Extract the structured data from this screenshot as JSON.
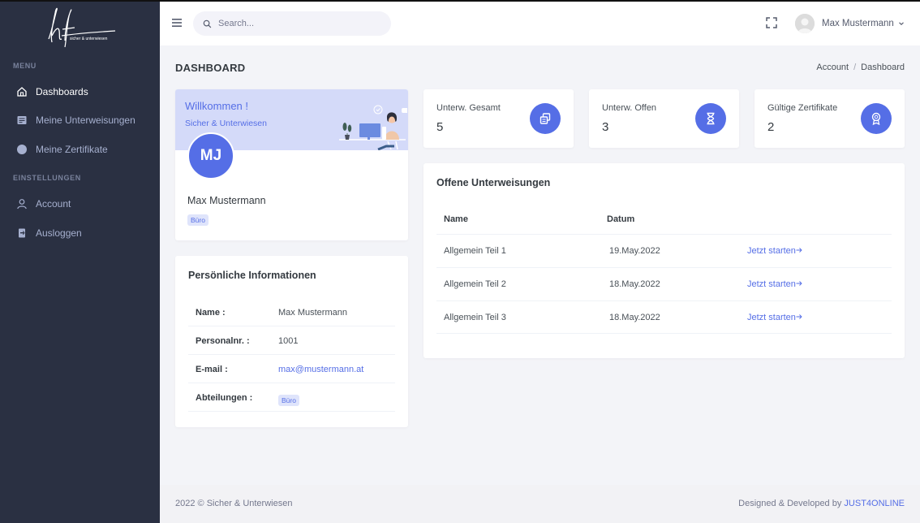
{
  "logo": {
    "text": "sicher & unterwiesen"
  },
  "sidebar": {
    "menu_title": "MENU",
    "settings_title": "EINSTELLUNGEN",
    "items": [
      {
        "label": "Dashboards",
        "icon": "home-icon"
      },
      {
        "label": "Meine Unterweisungen",
        "icon": "document-icon"
      },
      {
        "label": "Meine Zertifikate",
        "icon": "circle-icon"
      },
      {
        "label": "Account",
        "icon": "user-icon"
      },
      {
        "label": "Ausloggen",
        "icon": "logout-icon"
      }
    ]
  },
  "topbar": {
    "search_placeholder": "Search...",
    "user_name": "Max Mustermann"
  },
  "page": {
    "title": "DASHBOARD",
    "breadcrumb": [
      "Account",
      "Dashboard"
    ]
  },
  "welcome": {
    "title": "Willkommen !",
    "subtitle": "Sicher & Unterwiesen",
    "initials": "MJ",
    "name": "Max Mustermann",
    "department": "Büro"
  },
  "personal_info": {
    "title": "Persönliche Informationen",
    "rows": [
      {
        "key": "Name :",
        "value": "Max Mustermann"
      },
      {
        "key": "Personalnr. :",
        "value": "1001"
      },
      {
        "key": "E-mail :",
        "value": "max@mustermann.at"
      },
      {
        "key": "Abteilungen :",
        "value": "Büro"
      }
    ]
  },
  "stats": [
    {
      "label": "Unterw. Gesamt",
      "value": "5",
      "icon": "copy-icon"
    },
    {
      "label": "Unterw. Offen",
      "value": "3",
      "icon": "hourglass-icon"
    },
    {
      "label": "Gültige Zertifikate",
      "value": "2",
      "icon": "award-icon"
    }
  ],
  "open_trainings": {
    "title": "Offene Unterweisungen",
    "columns": [
      "Name",
      "Datum"
    ],
    "rows": [
      {
        "name": "Allgemein Teil 1",
        "date": "19.May.2022",
        "action": "Jetzt starten"
      },
      {
        "name": "Allgemein Teil 2",
        "date": "18.May.2022",
        "action": "Jetzt starten"
      },
      {
        "name": "Allgemein Teil 3",
        "date": "18.May.2022",
        "action": "Jetzt starten"
      }
    ]
  },
  "footer": {
    "copyright": "2022 © Sicher & Unterwiesen",
    "designed_by": "Designed & Developed by",
    "brand": "JUST4ONLINE"
  },
  "colors": {
    "accent": "#556ee6",
    "sidebar_bg": "#2a3042",
    "welcome_bg": "#d4daf9"
  }
}
